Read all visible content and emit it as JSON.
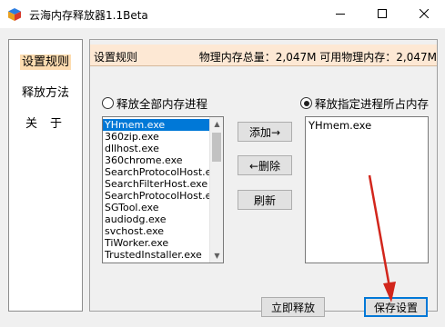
{
  "window": {
    "title": "云海内存释放器1.1Beta",
    "icon": "app-cube-icon",
    "controls": [
      "minimize-icon",
      "maximize-icon",
      "close-icon"
    ]
  },
  "sidebar": {
    "items": [
      {
        "label": "设置规则",
        "active": true
      },
      {
        "label": "释放方法",
        "active": false
      },
      {
        "label": "关于",
        "active": false
      }
    ]
  },
  "panel": {
    "title": "设置规则",
    "memory_info": "物理内存总量：2,047M 可用物理内存：2,047M"
  },
  "options": {
    "release_all": "释放全部内存进程",
    "release_selected": "释放指定进程所占内存",
    "selected_option": "release_selected"
  },
  "process_list": {
    "items": [
      "YHmem.exe",
      "360zip.exe",
      "dllhost.exe",
      "360chrome.exe",
      "SearchProtocolHost.exe",
      "SearchFilterHost.exe",
      "SearchProtocolHost.exe",
      "SGTool.exe",
      "audiodg.exe",
      "svchost.exe",
      "TiWorker.exe",
      "TrustedInstaller.exe"
    ],
    "selected_index": 0
  },
  "buttons": {
    "add": "添加→",
    "remove": "←删除",
    "refresh": "刷新",
    "release_now": "立即释放",
    "save": "保存设置"
  },
  "selected_list": {
    "items": [
      "YHmem.exe"
    ]
  },
  "colors": {
    "header_bg": "#fde8d4",
    "active_nav_bg": "#fddcb0",
    "selection": "#0078d7",
    "annotation_arrow": "#d2261c"
  }
}
